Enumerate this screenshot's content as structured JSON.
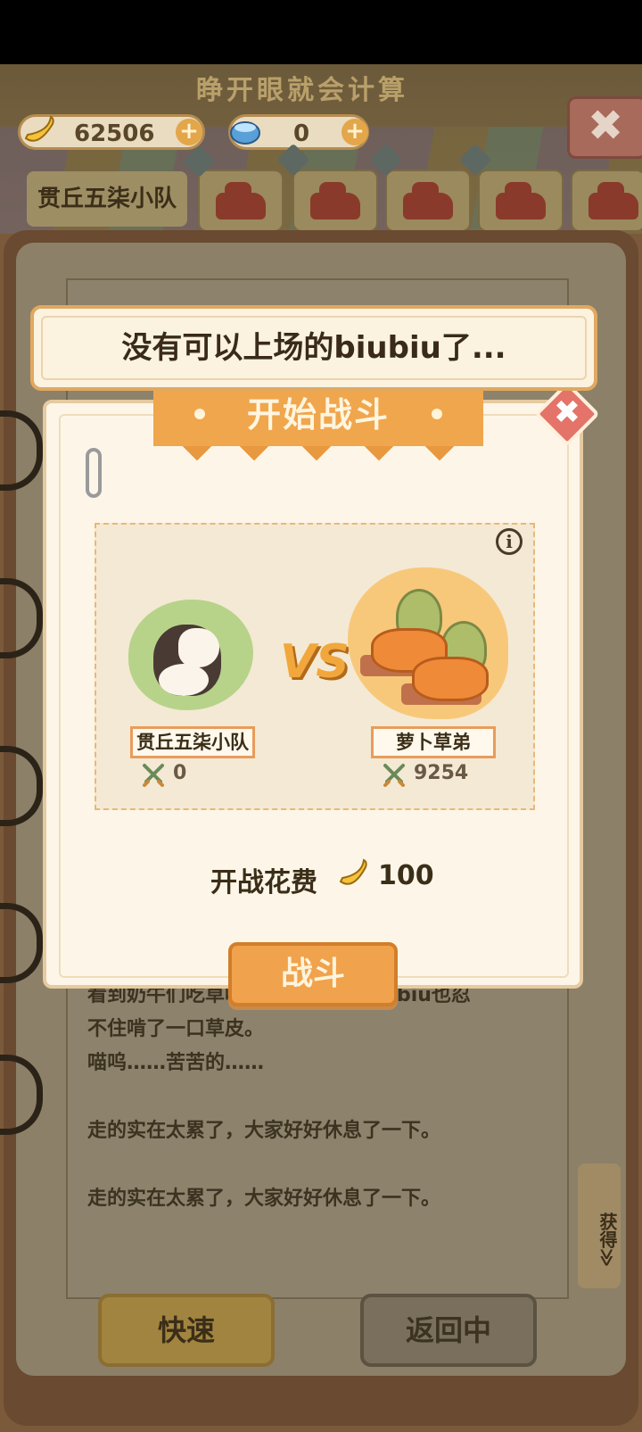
{
  "header": {
    "faded_title": "睁开眼就会计算",
    "banana_count": "62506",
    "gem_count": "0",
    "plus_symbol": "+",
    "team_name": "贯丘五柒小队",
    "close_symbol": "✖"
  },
  "toast": {
    "message": "没有可以上场的biubiu了..."
  },
  "dialog": {
    "title": "开始战斗",
    "close_symbol": "✖",
    "info_symbol": "i",
    "vs_text": "VS",
    "ours": {
      "name": "贯丘五柒小队",
      "power": "0"
    },
    "enemy": {
      "name": "萝卜草弟",
      "power": "9254"
    },
    "cost_label": "开战花费",
    "cost_value": "100",
    "fight_button": "战斗"
  },
  "story": {
    "lines": [
      "看到奶牛们吃草吃得那么香甜，biubiu也忍",
      "不住啃了一口草皮。",
      "喵呜……苦苦的……",
      "走的实在太累了，大家好好休息了一下。",
      "走的实在太累了，大家好好休息了一下。"
    ]
  },
  "bottom": {
    "quick_button": "快速",
    "return_button": "返回中",
    "side_tag": "获得≫"
  },
  "colors": {
    "accent_orange": "#f0a24c",
    "toast_border": "#e0a860",
    "dialog_bg": "#fdf6e8"
  }
}
